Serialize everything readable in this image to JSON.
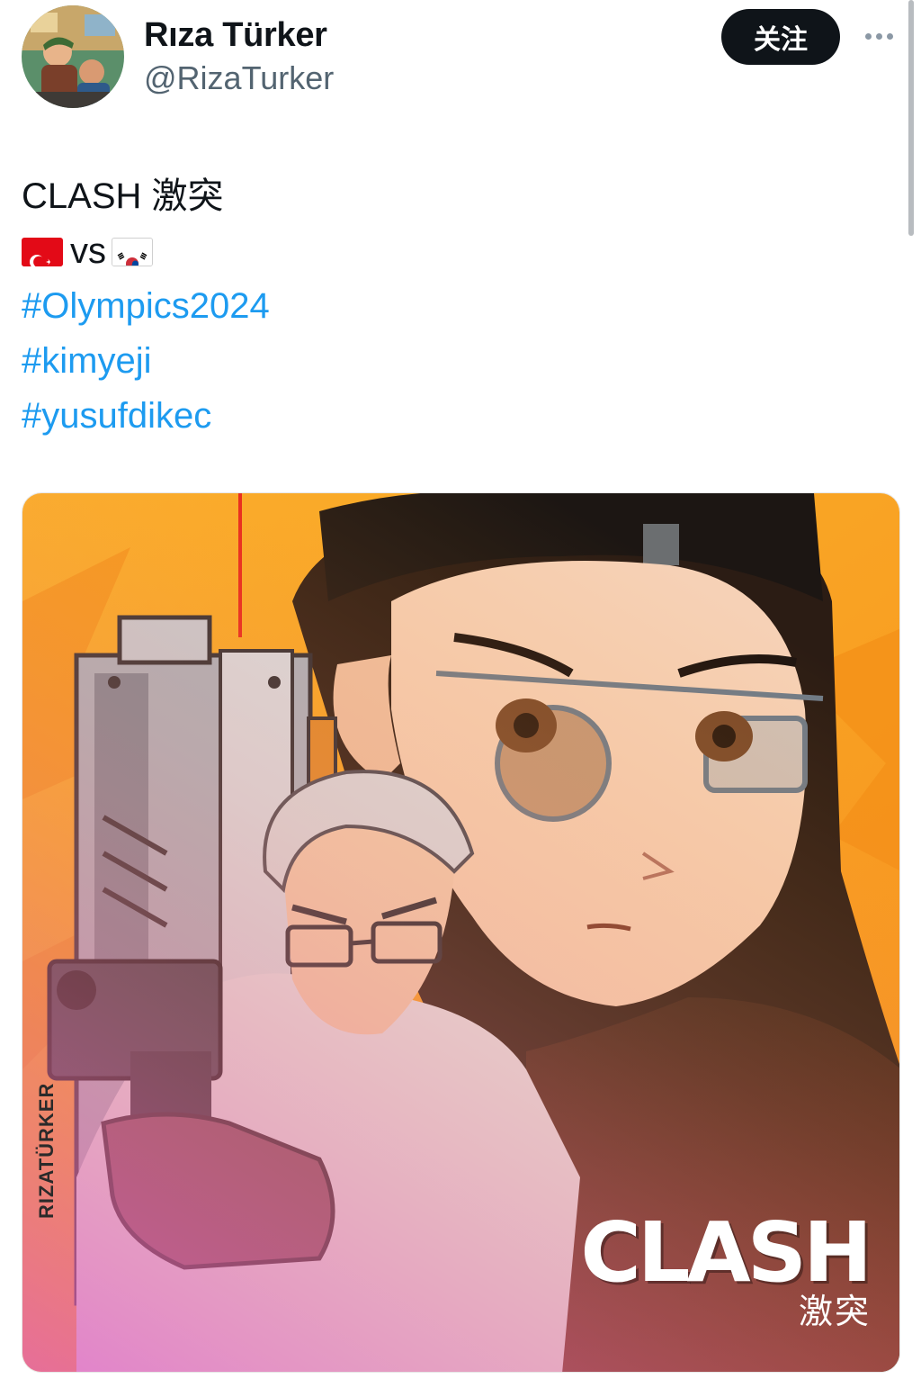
{
  "author": {
    "name": "Rıza Türker",
    "handle": "@RizaTurker",
    "avatar_icon": "avatar-illustration"
  },
  "header": {
    "follow_label": "关注",
    "more_icon": "more-horizontal-icon"
  },
  "tweet": {
    "title_line": "CLASH 激突",
    "flag_left": "flag-turkey-icon",
    "vs": "vs",
    "flag_right": "flag-south-korea-icon",
    "hashtags": [
      "#Olympics2024",
      "#kimyeji",
      "#yusufdikec"
    ]
  },
  "media": {
    "title": "CLASH",
    "subtitle": "激突",
    "signature": "RIZATÜRKER",
    "colors": {
      "background": "#f9a21e",
      "background_dark": "#3b2016",
      "laser": "#e8251c"
    }
  }
}
